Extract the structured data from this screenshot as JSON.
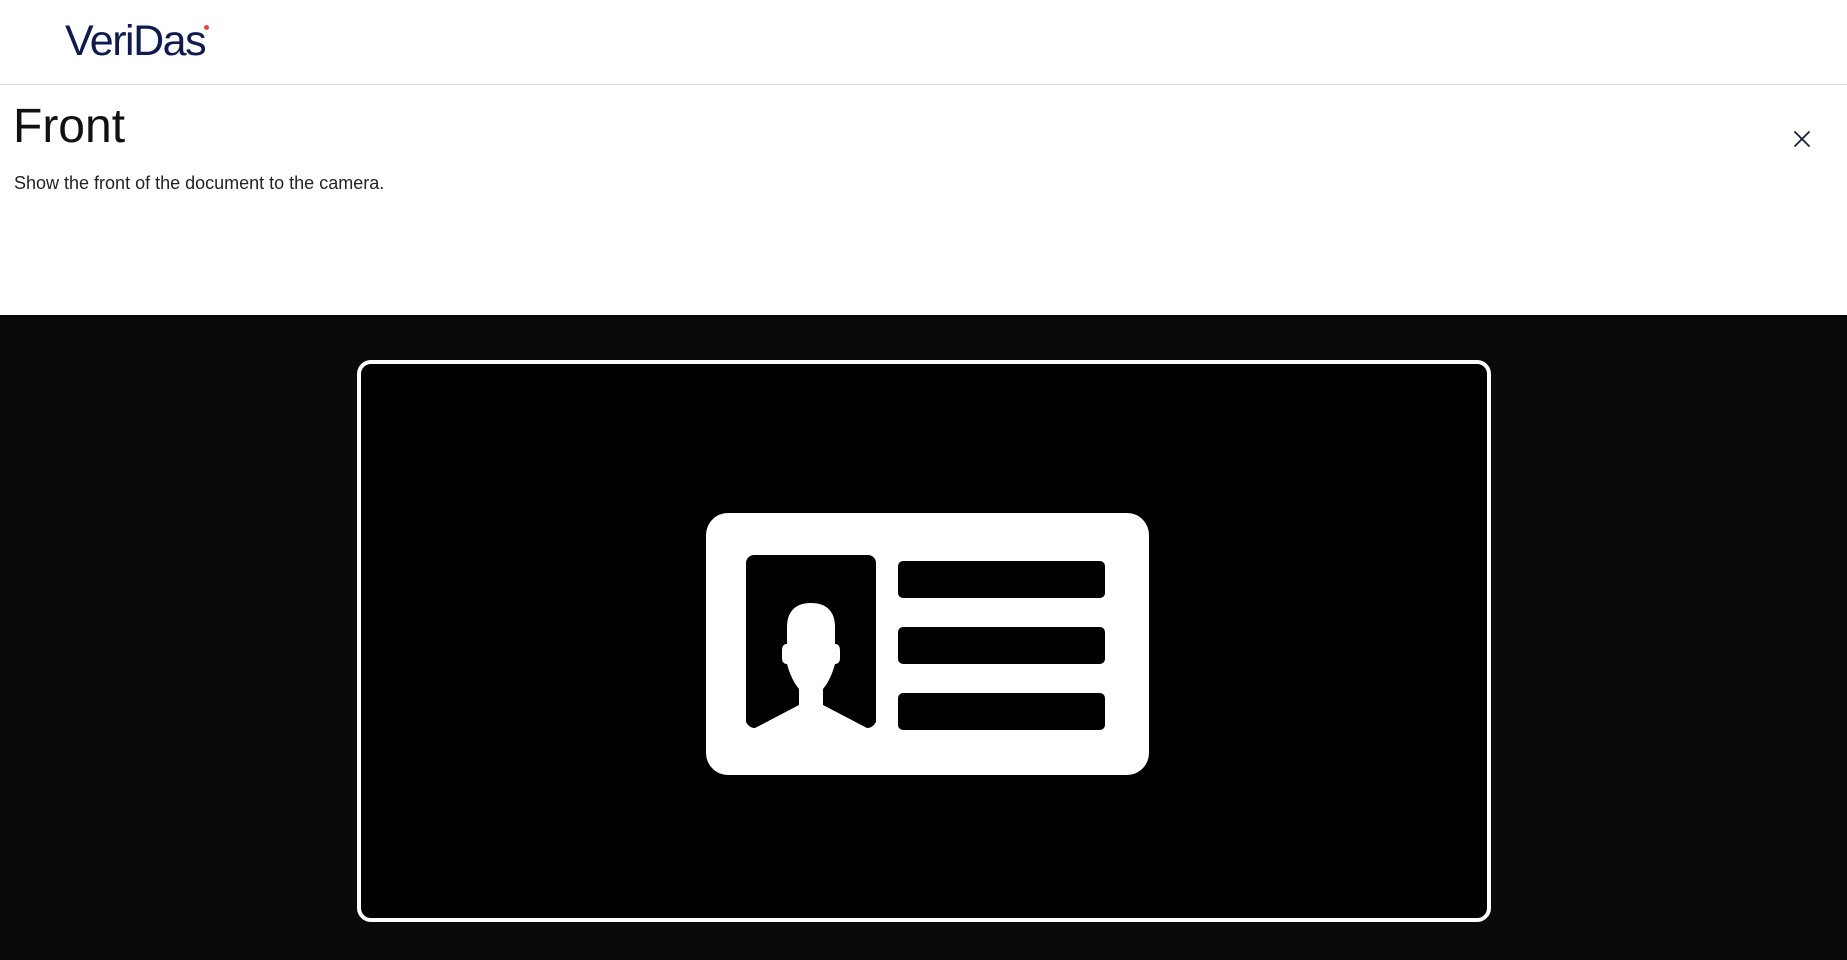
{
  "header": {
    "logo_text": "VeriDas",
    "brand_color": "#0f1a4f",
    "logo_accent_color": "#e8453c"
  },
  "main": {
    "title": "Front",
    "instruction": "Show the front of the document to the camera."
  },
  "icons": {
    "close": "close-icon",
    "document": "id-card-icon"
  },
  "colors": {
    "camera_background": "#0a0a0a",
    "frame_border": "#ffffff"
  }
}
